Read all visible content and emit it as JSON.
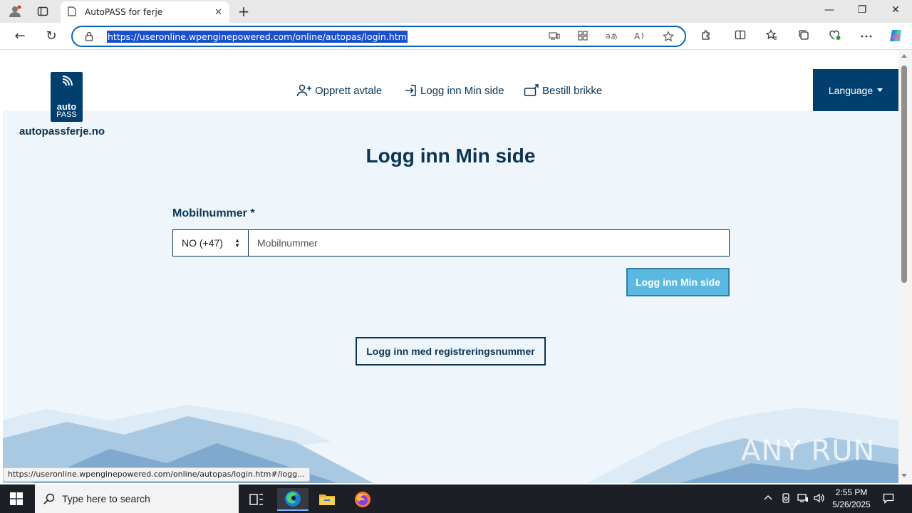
{
  "browser": {
    "tab_title": "AutoPASS for ferje",
    "new_tab_symbol": "+",
    "url": "https://useronline.wpenginepowered.com/online/autopas/login.htm",
    "status_url": "https://useronline.wpenginepowered.com/online/autopas/login.htm#/logg...",
    "window_controls": {
      "minimize": "—",
      "restore": "❐",
      "close": "✕"
    },
    "nav": {
      "back": "←",
      "refresh": "↻"
    },
    "accent_color": "#0c64c0"
  },
  "site": {
    "logo_line1": "auto",
    "logo_line2": "PASS",
    "name": "autopassferje.no",
    "nav": [
      {
        "label": "Opprett avtale",
        "icon": "user-add-icon"
      },
      {
        "label": "Logg inn Min side",
        "icon": "login-icon"
      },
      {
        "label": "Bestill brikke",
        "icon": "tag-order-icon"
      }
    ],
    "language_label": "Language",
    "brand_color": "#003f6e"
  },
  "login": {
    "title": "Logg inn Min side",
    "mobile_label": "Mobilnummer *",
    "country_code": "NO (+47)",
    "mobile_placeholder": "Mobilnummer",
    "submit_label": "Logg inn Min side",
    "regnr_label": "Logg inn med registreringsnummer"
  },
  "watermark": "ANY RUN",
  "taskbar": {
    "search_placeholder": "Type here to search",
    "time": "2:55 PM",
    "date": "5/26/2025"
  }
}
